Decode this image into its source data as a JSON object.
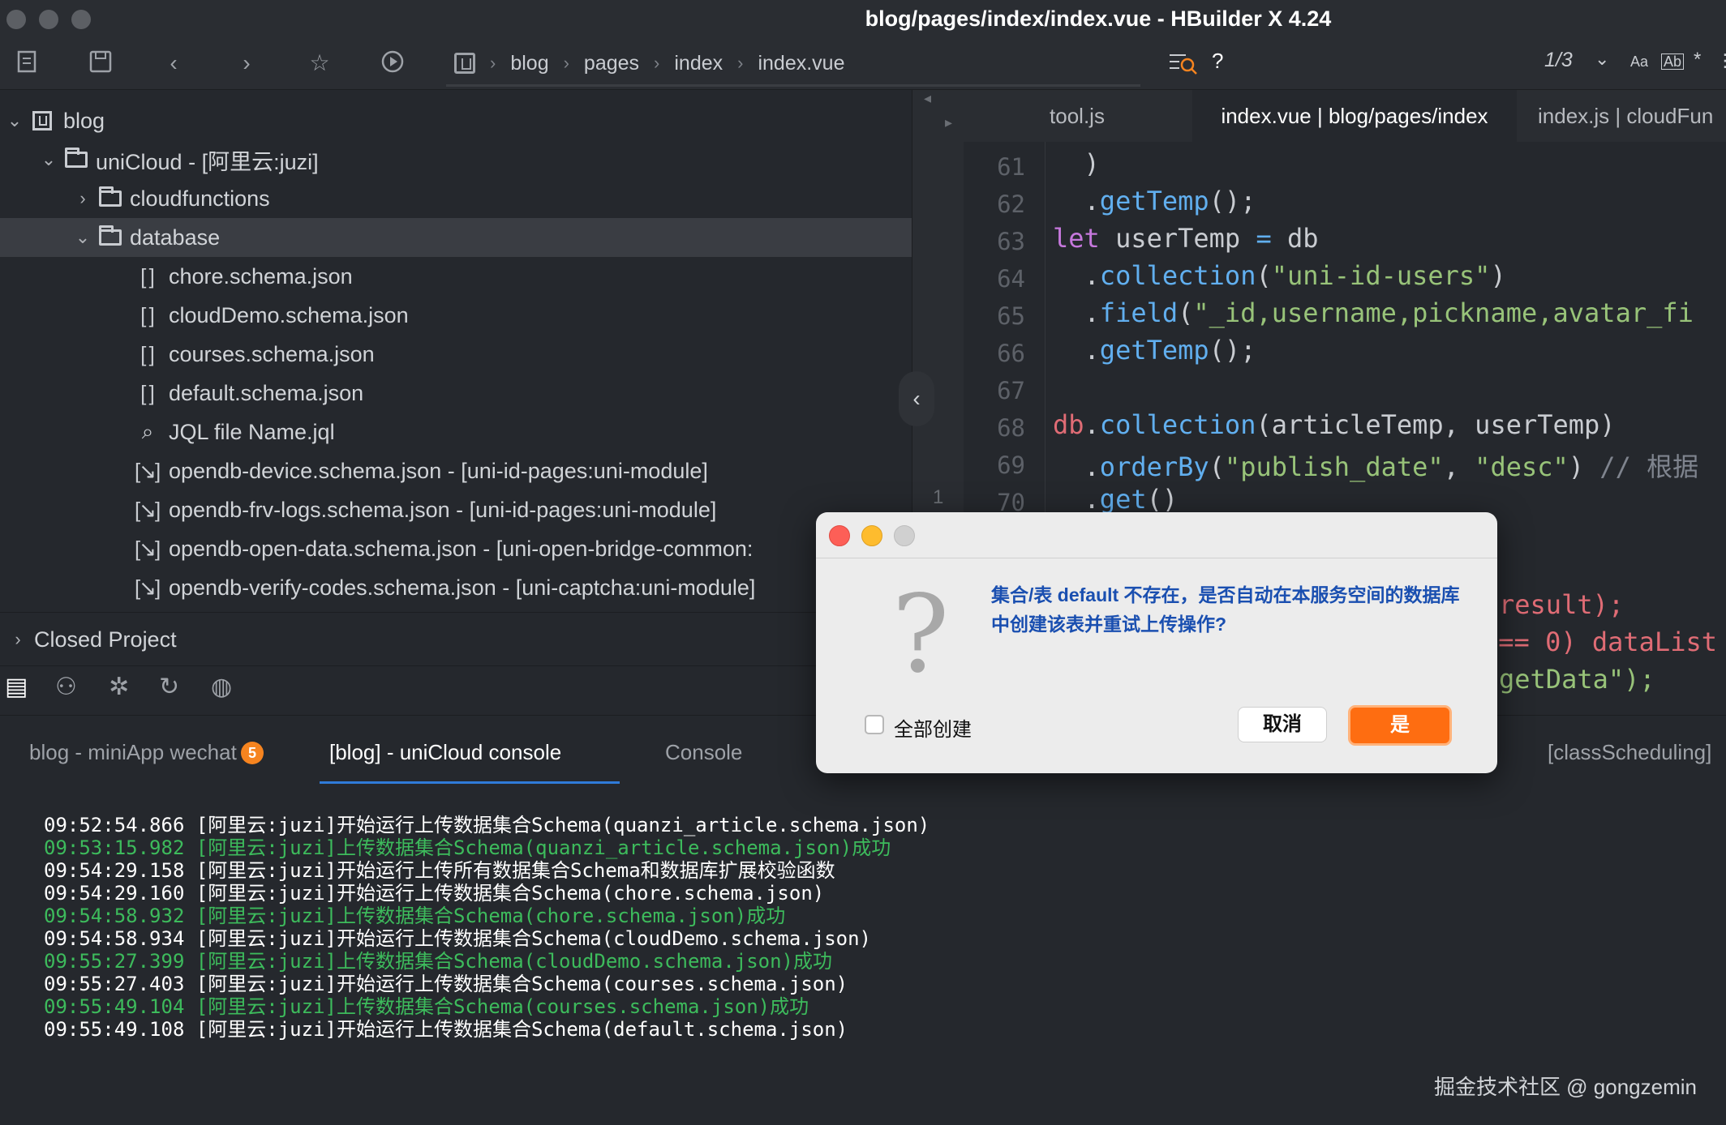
{
  "window": {
    "title": "blog/pages/index/index.vue - HBuilder X 4.24"
  },
  "breadcrumb": {
    "items": [
      "blog",
      "pages",
      "index",
      "index.vue"
    ]
  },
  "find": {
    "help": "?",
    "match_count": "1/3",
    "case_label": "Aa",
    "word_label": "Ab",
    "regex_label": "*"
  },
  "tree": {
    "items": [
      {
        "label": "blog"
      },
      {
        "label": "uniCloud - [阿里云:juzi]"
      },
      {
        "label": "cloudfunctions"
      },
      {
        "label": "database"
      },
      {
        "label": "chore.schema.json"
      },
      {
        "label": "cloudDemo.schema.json"
      },
      {
        "label": "courses.schema.json"
      },
      {
        "label": "default.schema.json"
      },
      {
        "label": "JQL file Name.jql"
      },
      {
        "label": "opendb-device.schema.json - [uni-id-pages:uni-module]"
      },
      {
        "label": "opendb-frv-logs.schema.json - [uni-id-pages:uni-module]"
      },
      {
        "label": "opendb-open-data.schema.json - [uni-open-bridge-common:"
      },
      {
        "label": "opendb-verify-codes.schema.json - [uni-captcha:uni-module]"
      }
    ],
    "closed_project": "Closed Project"
  },
  "editor": {
    "tabs": [
      "tool.js",
      "index.vue | blog/pages/index",
      "index.js | cloudFun"
    ],
    "line_numbers": [
      "61",
      "62",
      "63",
      "64",
      "65",
      "66",
      "67",
      "68",
      "69",
      "70"
    ],
    "minimap_number": "1",
    "code_tail": [
      "result);",
      "=== 0) dataList",
      "getData\");"
    ]
  },
  "console": {
    "tabs": [
      "blog - miniApp wechat",
      "[blog] - uniCloud console",
      "Console",
      "[classScheduling]"
    ],
    "badge": "5",
    "logs": [
      "09:52:54.866 [阿里云:juzi]开始运行上传数据集合Schema(quanzi_article.schema.json)",
      "09:53:15.982 [阿里云:juzi]上传数据集合Schema(quanzi_article.schema.json)成功",
      "09:54:29.158 [阿里云:juzi]开始运行上传所有数据集合Schema和数据库扩展校验函数",
      "09:54:29.160 [阿里云:juzi]开始运行上传数据集合Schema(chore.schema.json)",
      "09:54:58.932 [阿里云:juzi]上传数据集合Schema(chore.schema.json)成功",
      "09:54:58.934 [阿里云:juzi]开始运行上传数据集合Schema(cloudDemo.schema.json)",
      "09:55:27.399 [阿里云:juzi]上传数据集合Schema(cloudDemo.schema.json)成功",
      "09:55:27.403 [阿里云:juzi]开始运行上传数据集合Schema(courses.schema.json)",
      "09:55:49.104 [阿里云:juzi]上传数据集合Schema(courses.schema.json)成功",
      "09:55:49.108 [阿里云:juzi]开始运行上传数据集合Schema(default.schema.json)"
    ]
  },
  "dialog": {
    "message": "集合/表 default 不存在，是否自动在本服务空间的数据库中创建该表并重试上传操作?",
    "checkbox_label": "全部创建",
    "cancel_label": "取消",
    "yes_label": "是"
  },
  "watermark": "掘金技术社区 @ gongzemin",
  "colors": {
    "accent": "#2f7bd9",
    "primary_button": "#fe6d11",
    "success_log": "#3dbb5c"
  }
}
